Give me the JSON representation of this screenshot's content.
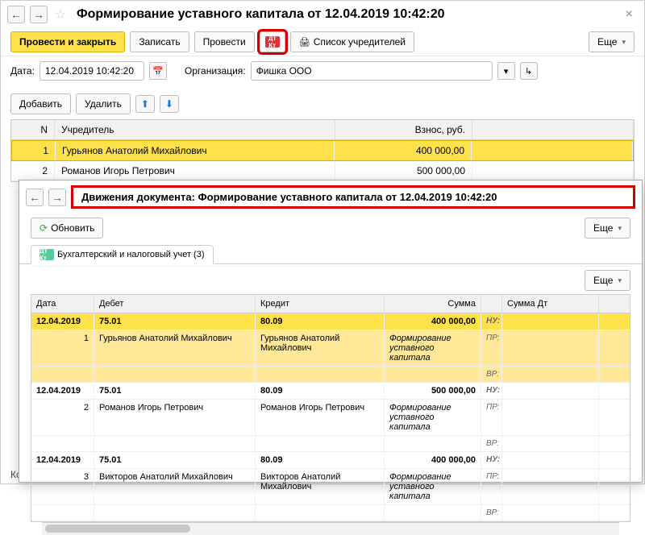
{
  "header": {
    "title": "Формирование уставного капитала от 12.04.2019 10:42:20"
  },
  "toolbar": {
    "post_close": "Провести и закрыть",
    "write": "Записать",
    "post": "Провести",
    "founders_list": "Список учредителей",
    "more": "Еще"
  },
  "form": {
    "date_label": "Дата:",
    "date_value": "12.04.2019 10:42:20",
    "org_label": "Организация:",
    "org_value": "Фишка ООО"
  },
  "grid_toolbar": {
    "add": "Добавить",
    "delete": "Удалить"
  },
  "grid": {
    "headers": {
      "n": "N",
      "founder": "Учредитель",
      "amount": "Взнос, руб."
    },
    "rows": [
      {
        "n": "1",
        "founder": "Гурьянов Анатолий Михайлович",
        "amount": "400 000,00"
      },
      {
        "n": "2",
        "founder": "Романов Игорь Петрович",
        "amount": "500 000,00"
      }
    ]
  },
  "sub": {
    "title": "Движения документа: Формирование уставного капитала от 12.04.2019 10:42:20",
    "refresh": "Обновить",
    "more": "Еще",
    "tab": "Бухгалтерский и налоговый учет (3)"
  },
  "moves": {
    "headers": {
      "date": "Дата",
      "debet": "Дебет",
      "kredit": "Кредит",
      "sum": "Сумма",
      "sumdt": "Сумма Дт"
    },
    "labels": {
      "nu": "НУ:",
      "pr": "ПР:",
      "br": "ВР:"
    },
    "groups": [
      {
        "date": "12.04.2019",
        "n": "1",
        "debet_acc": "75.01",
        "kredit_acc": "80.09",
        "sum": "400 000,00",
        "d_sub": "Гурьянов Анатолий Михайлович",
        "k_sub": "Гурьянов Анатолий Михайлович",
        "desc": "Формирование уставного капитала",
        "highlight": true
      },
      {
        "date": "12.04.2019",
        "n": "2",
        "debet_acc": "75.01",
        "kredit_acc": "80.09",
        "sum": "500 000,00",
        "d_sub": "Романов Игорь Петрович",
        "k_sub": "Романов Игорь Петрович",
        "desc": "Формирование уставного капитала",
        "highlight": false
      },
      {
        "date": "12.04.2019",
        "n": "3",
        "debet_acc": "75.01",
        "kredit_acc": "80.09",
        "sum": "400 000,00",
        "d_sub": "Викторов Анатолий Михайлович",
        "k_sub": "Викторов Анатолий Михайлович",
        "desc": "Формирование уставного капитала",
        "highlight": false
      }
    ]
  },
  "footer": {
    "comment": "Ком"
  }
}
